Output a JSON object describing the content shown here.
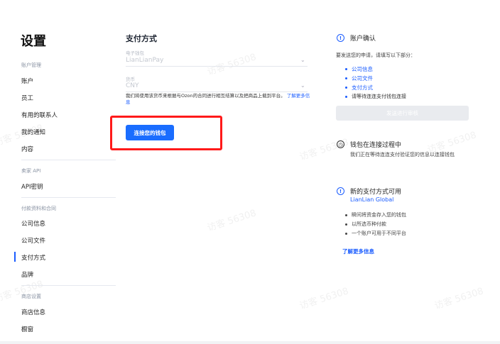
{
  "watermark": "访客 56308",
  "sidebar": {
    "title": "设置",
    "sections": [
      {
        "label": "账户管理",
        "items": [
          "账户",
          "员工",
          "有用的联系人",
          "我的通知",
          "内容"
        ]
      },
      {
        "label": "卖家 API",
        "items": [
          "API密钥"
        ]
      },
      {
        "label": "付款资料和合同",
        "items": [
          "公司信息",
          "公司文件",
          "支付方式",
          "品牌"
        ]
      },
      {
        "label": "商店设置",
        "items": [
          "商店信息",
          "橱窗"
        ]
      }
    ],
    "active": "支付方式"
  },
  "main": {
    "title": "支付方式",
    "wallet": {
      "label": "电子钱包",
      "value": "LianLianPay"
    },
    "currency": {
      "label": "货币",
      "value": "CNY"
    },
    "help_text": "我们将使用该货币来根据与Ozon的合同进行相互结算以及把商品上载到平台。",
    "help_link": "了解更多信息",
    "connect_button": "连接您的钱包"
  },
  "right": {
    "confirm": {
      "title": "账户确认",
      "intro": "要发送您的申请，请填写以下部分：",
      "items": [
        "公司信息",
        "公司文件",
        "支付方式",
        "请等待连连支付钱包连接"
      ],
      "button": "发送进行审核"
    },
    "pending": {
      "title": "钱包在连接过程中",
      "text": "我们正在等待连连支付验证您的信息以连接钱包"
    },
    "new": {
      "title": "新的支付方式可用",
      "brand": "LianLian Global",
      "items": [
        "瞬间将资金存入您的钱包",
        "以所选币种付款",
        "一个账户可用于不同平台"
      ],
      "link": "了解更多信息"
    }
  },
  "colors": {
    "accent": "#1a6dff",
    "highlight": "#ff1a1a"
  }
}
